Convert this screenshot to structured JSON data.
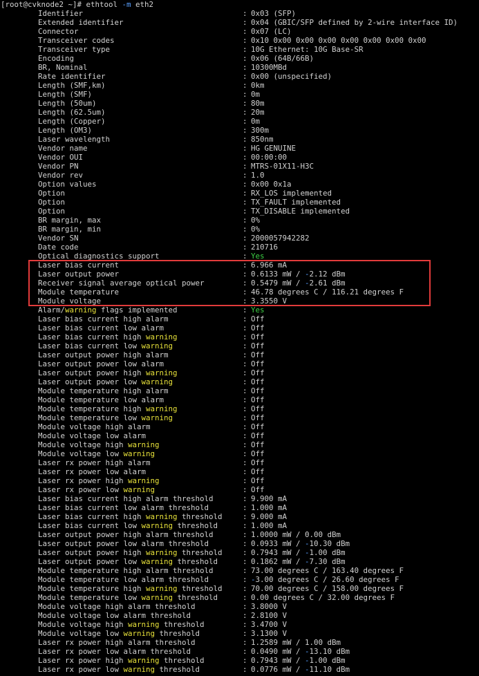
{
  "prompt": {
    "user_host": "[root@cvknode2 ~]# ",
    "command": "ethtool ",
    "flag": "-m",
    "interface": " eth2"
  },
  "colors": {
    "background": "#000000",
    "text": "#d2d2d2",
    "keyword_warning": "#e8e23a",
    "yes": "#3ecf45",
    "negative": "#5aa0ff",
    "highlight_border": "#e23b3b"
  },
  "rows": [
    {
      "key": [
        {
          "t": "Identifier"
        }
      ],
      "value": [
        {
          "t": "0x03 (SFP)"
        }
      ]
    },
    {
      "key": [
        {
          "t": "Extended identifier"
        }
      ],
      "value": [
        {
          "t": "0x04 (GBIC/SFP defined by 2-wire interface ID)"
        }
      ]
    },
    {
      "key": [
        {
          "t": "Connector"
        }
      ],
      "value": [
        {
          "t": "0x07 (LC)"
        }
      ]
    },
    {
      "key": [
        {
          "t": "Transceiver codes"
        }
      ],
      "value": [
        {
          "t": "0x10 0x00 0x00 0x00 0x00 0x00 0x00 0x00"
        }
      ]
    },
    {
      "key": [
        {
          "t": "Transceiver type"
        }
      ],
      "value": [
        {
          "t": "10G Ethernet: 10G Base-SR"
        }
      ]
    },
    {
      "key": [
        {
          "t": "Encoding"
        }
      ],
      "value": [
        {
          "t": "0x06 (64B/66B)"
        }
      ]
    },
    {
      "key": [
        {
          "t": "BR, Nominal"
        }
      ],
      "value": [
        {
          "t": "10300MBd"
        }
      ]
    },
    {
      "key": [
        {
          "t": "Rate identifier"
        }
      ],
      "value": [
        {
          "t": "0x00 (unspecified)"
        }
      ]
    },
    {
      "key": [
        {
          "t": "Length (SMF,km)"
        }
      ],
      "value": [
        {
          "t": "0km"
        }
      ]
    },
    {
      "key": [
        {
          "t": "Length (SMF)"
        }
      ],
      "value": [
        {
          "t": "0m"
        }
      ]
    },
    {
      "key": [
        {
          "t": "Length (50um)"
        }
      ],
      "value": [
        {
          "t": "80m"
        }
      ]
    },
    {
      "key": [
        {
          "t": "Length (62.5um)"
        }
      ],
      "value": [
        {
          "t": "20m"
        }
      ]
    },
    {
      "key": [
        {
          "t": "Length (Copper)"
        }
      ],
      "value": [
        {
          "t": "0m"
        }
      ]
    },
    {
      "key": [
        {
          "t": "Length (OM3)"
        }
      ],
      "value": [
        {
          "t": "300m"
        }
      ]
    },
    {
      "key": [
        {
          "t": "Laser wavelength"
        }
      ],
      "value": [
        {
          "t": "850nm"
        }
      ]
    },
    {
      "key": [
        {
          "t": "Vendor name"
        }
      ],
      "value": [
        {
          "t": "HG GENUINE"
        }
      ]
    },
    {
      "key": [
        {
          "t": "Vendor OUI"
        }
      ],
      "value": [
        {
          "t": "00:00:00"
        }
      ]
    },
    {
      "key": [
        {
          "t": "Vendor PN"
        }
      ],
      "value": [
        {
          "t": "MTRS-01X11-H3C"
        }
      ]
    },
    {
      "key": [
        {
          "t": "Vendor rev"
        }
      ],
      "value": [
        {
          "t": "1.0"
        }
      ]
    },
    {
      "key": [
        {
          "t": "Option values"
        }
      ],
      "value": [
        {
          "t": "0x00 0x1a"
        }
      ]
    },
    {
      "key": [
        {
          "t": "Option"
        }
      ],
      "value": [
        {
          "t": "RX_LOS implemented"
        }
      ]
    },
    {
      "key": [
        {
          "t": "Option"
        }
      ],
      "value": [
        {
          "t": "TX_FAULT implemented"
        }
      ]
    },
    {
      "key": [
        {
          "t": "Option"
        }
      ],
      "value": [
        {
          "t": "TX_DISABLE implemented"
        }
      ]
    },
    {
      "key": [
        {
          "t": "BR margin, max"
        }
      ],
      "value": [
        {
          "t": "0%"
        }
      ]
    },
    {
      "key": [
        {
          "t": "BR margin, min"
        }
      ],
      "value": [
        {
          "t": "0%"
        }
      ]
    },
    {
      "key": [
        {
          "t": "Vendor SN"
        }
      ],
      "value": [
        {
          "t": "2000057942282"
        }
      ]
    },
    {
      "key": [
        {
          "t": "Date code"
        }
      ],
      "value": [
        {
          "t": "210716"
        }
      ]
    },
    {
      "key": [
        {
          "t": "Optical diagnostics support"
        }
      ],
      "value": [
        {
          "t": "Yes",
          "c": "yes"
        }
      ]
    },
    {
      "key": [
        {
          "t": "Laser bias current"
        }
      ],
      "value": [
        {
          "t": "6.966 mA"
        }
      ]
    },
    {
      "key": [
        {
          "t": "Laser output power"
        }
      ],
      "value": [
        {
          "t": "0.6133 mW / "
        },
        {
          "t": "-",
          "c": "neg"
        },
        {
          "t": "2.12 dBm"
        }
      ]
    },
    {
      "key": [
        {
          "t": "Receiver signal average optical power"
        }
      ],
      "value": [
        {
          "t": "0.5479 mW / "
        },
        {
          "t": "-",
          "c": "neg"
        },
        {
          "t": "2.61 dBm"
        }
      ]
    },
    {
      "key": [
        {
          "t": "Module temperature"
        }
      ],
      "value": [
        {
          "t": "46.78 degrees C / 116.21 degrees F"
        }
      ]
    },
    {
      "key": [
        {
          "t": "Module voltage"
        }
      ],
      "value": [
        {
          "t": "3.3550 V"
        }
      ]
    },
    {
      "key": [
        {
          "t": "Alarm/"
        },
        {
          "t": "warning",
          "c": "kw"
        },
        {
          "t": " flags implemented"
        }
      ],
      "value": [
        {
          "t": "Yes",
          "c": "yes"
        }
      ]
    },
    {
      "key": [
        {
          "t": "Laser bias current high alarm"
        }
      ],
      "value": [
        {
          "t": "Off"
        }
      ]
    },
    {
      "key": [
        {
          "t": "Laser bias current low alarm"
        }
      ],
      "value": [
        {
          "t": "Off"
        }
      ]
    },
    {
      "key": [
        {
          "t": "Laser bias current high "
        },
        {
          "t": "warning",
          "c": "kw"
        }
      ],
      "value": [
        {
          "t": "Off"
        }
      ]
    },
    {
      "key": [
        {
          "t": "Laser bias current low "
        },
        {
          "t": "warning",
          "c": "kw"
        }
      ],
      "value": [
        {
          "t": "Off"
        }
      ]
    },
    {
      "key": [
        {
          "t": "Laser output power high alarm"
        }
      ],
      "value": [
        {
          "t": "Off"
        }
      ]
    },
    {
      "key": [
        {
          "t": "Laser output power low alarm"
        }
      ],
      "value": [
        {
          "t": "Off"
        }
      ]
    },
    {
      "key": [
        {
          "t": "Laser output power high "
        },
        {
          "t": "warning",
          "c": "kw"
        }
      ],
      "value": [
        {
          "t": "Off"
        }
      ]
    },
    {
      "key": [
        {
          "t": "Laser output power low "
        },
        {
          "t": "warning",
          "c": "kw"
        }
      ],
      "value": [
        {
          "t": "Off"
        }
      ]
    },
    {
      "key": [
        {
          "t": "Module temperature high alarm"
        }
      ],
      "value": [
        {
          "t": "Off"
        }
      ]
    },
    {
      "key": [
        {
          "t": "Module temperature low alarm"
        }
      ],
      "value": [
        {
          "t": "Off"
        }
      ]
    },
    {
      "key": [
        {
          "t": "Module temperature high "
        },
        {
          "t": "warning",
          "c": "kw"
        }
      ],
      "value": [
        {
          "t": "Off"
        }
      ]
    },
    {
      "key": [
        {
          "t": "Module temperature low "
        },
        {
          "t": "warning",
          "c": "kw"
        }
      ],
      "value": [
        {
          "t": "Off"
        }
      ]
    },
    {
      "key": [
        {
          "t": "Module voltage high alarm"
        }
      ],
      "value": [
        {
          "t": "Off"
        }
      ]
    },
    {
      "key": [
        {
          "t": "Module voltage low alarm"
        }
      ],
      "value": [
        {
          "t": "Off"
        }
      ]
    },
    {
      "key": [
        {
          "t": "Module voltage high "
        },
        {
          "t": "warning",
          "c": "kw"
        }
      ],
      "value": [
        {
          "t": "Off"
        }
      ]
    },
    {
      "key": [
        {
          "t": "Module voltage low "
        },
        {
          "t": "warning",
          "c": "kw"
        }
      ],
      "value": [
        {
          "t": "Off"
        }
      ]
    },
    {
      "key": [
        {
          "t": "Laser rx power high alarm"
        }
      ],
      "value": [
        {
          "t": "Off"
        }
      ]
    },
    {
      "key": [
        {
          "t": "Laser rx power low alarm"
        }
      ],
      "value": [
        {
          "t": "Off"
        }
      ]
    },
    {
      "key": [
        {
          "t": "Laser rx power high "
        },
        {
          "t": "warning",
          "c": "kw"
        }
      ],
      "value": [
        {
          "t": "Off"
        }
      ]
    },
    {
      "key": [
        {
          "t": "Laser rx power low "
        },
        {
          "t": "warning",
          "c": "kw"
        }
      ],
      "value": [
        {
          "t": "Off"
        }
      ]
    },
    {
      "key": [
        {
          "t": "Laser bias current high alarm threshold"
        }
      ],
      "value": [
        {
          "t": "9.900 mA"
        }
      ]
    },
    {
      "key": [
        {
          "t": "Laser bias current low alarm threshold"
        }
      ],
      "value": [
        {
          "t": "1.000 mA"
        }
      ]
    },
    {
      "key": [
        {
          "t": "Laser bias current high "
        },
        {
          "t": "warning",
          "c": "kw"
        },
        {
          "t": " threshold"
        }
      ],
      "value": [
        {
          "t": "9.000 mA"
        }
      ]
    },
    {
      "key": [
        {
          "t": "Laser bias current low "
        },
        {
          "t": "warning",
          "c": "kw"
        },
        {
          "t": " threshold"
        }
      ],
      "value": [
        {
          "t": "1.000 mA"
        }
      ]
    },
    {
      "key": [
        {
          "t": "Laser output power high alarm threshold"
        }
      ],
      "value": [
        {
          "t": "1.0000 mW / 0.00 dBm"
        }
      ]
    },
    {
      "key": [
        {
          "t": "Laser output power low alarm threshold"
        }
      ],
      "value": [
        {
          "t": "0.0933 mW / "
        },
        {
          "t": "-",
          "c": "neg"
        },
        {
          "t": "10.30 dBm"
        }
      ]
    },
    {
      "key": [
        {
          "t": "Laser output power high "
        },
        {
          "t": "warning",
          "c": "kw"
        },
        {
          "t": " threshold"
        }
      ],
      "value": [
        {
          "t": "0.7943 mW / "
        },
        {
          "t": "-",
          "c": "neg"
        },
        {
          "t": "1.00 dBm"
        }
      ]
    },
    {
      "key": [
        {
          "t": "Laser output power low "
        },
        {
          "t": "warning",
          "c": "kw"
        },
        {
          "t": " threshold"
        }
      ],
      "value": [
        {
          "t": "0.1862 mW / "
        },
        {
          "t": "-",
          "c": "neg"
        },
        {
          "t": "7.30 dBm"
        }
      ]
    },
    {
      "key": [
        {
          "t": "Module temperature high alarm threshold"
        }
      ],
      "value": [
        {
          "t": "73.00 degrees C / 163.40 degrees F"
        }
      ]
    },
    {
      "key": [
        {
          "t": "Module temperature low alarm threshold"
        }
      ],
      "value": [
        {
          "t": "-",
          "c": "neg"
        },
        {
          "t": "3.00 degrees C / 26.60 degrees F"
        }
      ]
    },
    {
      "key": [
        {
          "t": "Module temperature high "
        },
        {
          "t": "warning",
          "c": "kw"
        },
        {
          "t": " threshold"
        }
      ],
      "value": [
        {
          "t": "70.00 degrees C / 158.00 degrees F"
        }
      ]
    },
    {
      "key": [
        {
          "t": "Module temperature low "
        },
        {
          "t": "warning",
          "c": "kw"
        },
        {
          "t": " threshold"
        }
      ],
      "value": [
        {
          "t": "0.00 degrees C / 32.00 degrees F"
        }
      ]
    },
    {
      "key": [
        {
          "t": "Module voltage high alarm threshold"
        }
      ],
      "value": [
        {
          "t": "3.8000 V"
        }
      ]
    },
    {
      "key": [
        {
          "t": "Module voltage low alarm threshold"
        }
      ],
      "value": [
        {
          "t": "2.8100 V"
        }
      ]
    },
    {
      "key": [
        {
          "t": "Module voltage high "
        },
        {
          "t": "warning",
          "c": "kw"
        },
        {
          "t": " threshold"
        }
      ],
      "value": [
        {
          "t": "3.4700 V"
        }
      ]
    },
    {
      "key": [
        {
          "t": "Module voltage low "
        },
        {
          "t": "warning",
          "c": "kw"
        },
        {
          "t": " threshold"
        }
      ],
      "value": [
        {
          "t": "3.1300 V"
        }
      ]
    },
    {
      "key": [
        {
          "t": "Laser rx power high alarm threshold"
        }
      ],
      "value": [
        {
          "t": "1.2589 mW / 1.00 dBm"
        }
      ]
    },
    {
      "key": [
        {
          "t": "Laser rx power low alarm threshold"
        }
      ],
      "value": [
        {
          "t": "0.0490 mW / "
        },
        {
          "t": "-",
          "c": "neg"
        },
        {
          "t": "13.10 dBm"
        }
      ]
    },
    {
      "key": [
        {
          "t": "Laser rx power high "
        },
        {
          "t": "warning",
          "c": "kw"
        },
        {
          "t": " threshold"
        }
      ],
      "value": [
        {
          "t": "0.7943 mW / "
        },
        {
          "t": "-",
          "c": "neg"
        },
        {
          "t": "1.00 dBm"
        }
      ]
    },
    {
      "key": [
        {
          "t": "Laser rx power low "
        },
        {
          "t": "warning",
          "c": "kw"
        },
        {
          "t": " threshold"
        }
      ],
      "value": [
        {
          "t": "0.0776 mW / "
        },
        {
          "t": "-",
          "c": "neg"
        },
        {
          "t": "11.10 dBm"
        }
      ]
    }
  ]
}
